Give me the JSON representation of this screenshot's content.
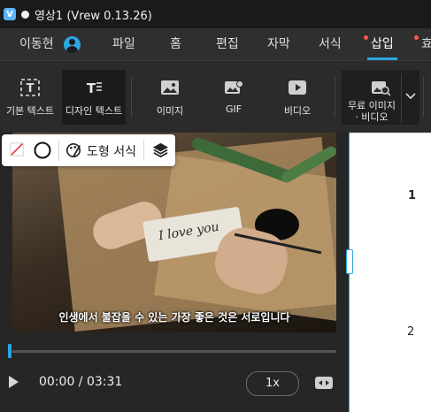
{
  "window": {
    "title": "영상1 (Vrew 0.13.26)"
  },
  "menu": {
    "user_name": "이동현",
    "items": [
      "파일",
      "홈",
      "편집",
      "자막",
      "서식",
      "삽입",
      "효"
    ],
    "active": "삽입",
    "accent_color": "#2aa6e0",
    "notify_color": "#ff5a4a"
  },
  "ribbon": {
    "buttons": [
      {
        "label": "기본 텍스트",
        "icon": "text-icon"
      },
      {
        "label": "디자인 텍스트",
        "icon": "design-text-icon"
      },
      {
        "label": "이미지",
        "icon": "image-icon"
      },
      {
        "label": "GIF",
        "icon": "gif-icon"
      },
      {
        "label": "비디오",
        "icon": "video-icon"
      },
      {
        "label": "무료 이미지\n· 비디오",
        "icon": "stock-media-icon"
      }
    ],
    "selected": "디자인 텍스트"
  },
  "shape_toolbar": {
    "format_label": "도형 서식"
  },
  "video": {
    "card_text": "I love you",
    "subtitle": "인생에서 불잡을 수 있는 가장 좋은 것은 서로입니다"
  },
  "player": {
    "time": "00:00 / 03:31",
    "speed": "1x",
    "progress": 0.0
  },
  "clips": {
    "numbers": [
      "1",
      "2"
    ]
  }
}
